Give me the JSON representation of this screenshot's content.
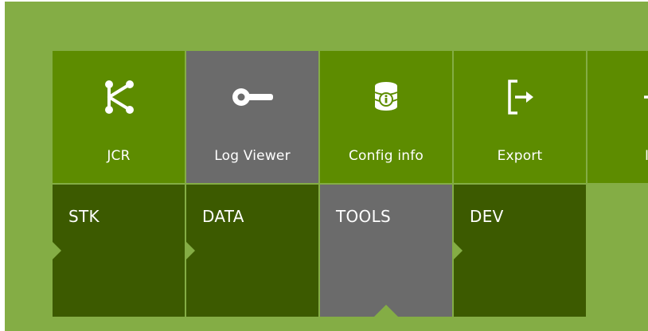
{
  "tools": [
    {
      "label": "JCR",
      "icon": "share-nodes-icon",
      "color": "#5d8c00"
    },
    {
      "label": "Log Viewer",
      "icon": "key-icon",
      "color": "#6b6b6b"
    },
    {
      "label": "Config info",
      "icon": "database-info-icon",
      "color": "#5d8c00"
    },
    {
      "label": "Export",
      "icon": "export-arrow-icon",
      "color": "#5d8c00"
    },
    {
      "label": "Im",
      "icon": "import-plus-icon",
      "color": "#5d8c00"
    }
  ],
  "categories": [
    {
      "label": "STK",
      "active": false
    },
    {
      "label": "DATA",
      "active": false
    },
    {
      "label": "TOOLS",
      "active": true
    },
    {
      "label": "DEV",
      "active": false
    }
  ],
  "colors": {
    "background": "#84ad45",
    "tile_green": "#5d8c00",
    "tile_gray": "#6b6b6b",
    "category_dark": "#3c5a00"
  }
}
